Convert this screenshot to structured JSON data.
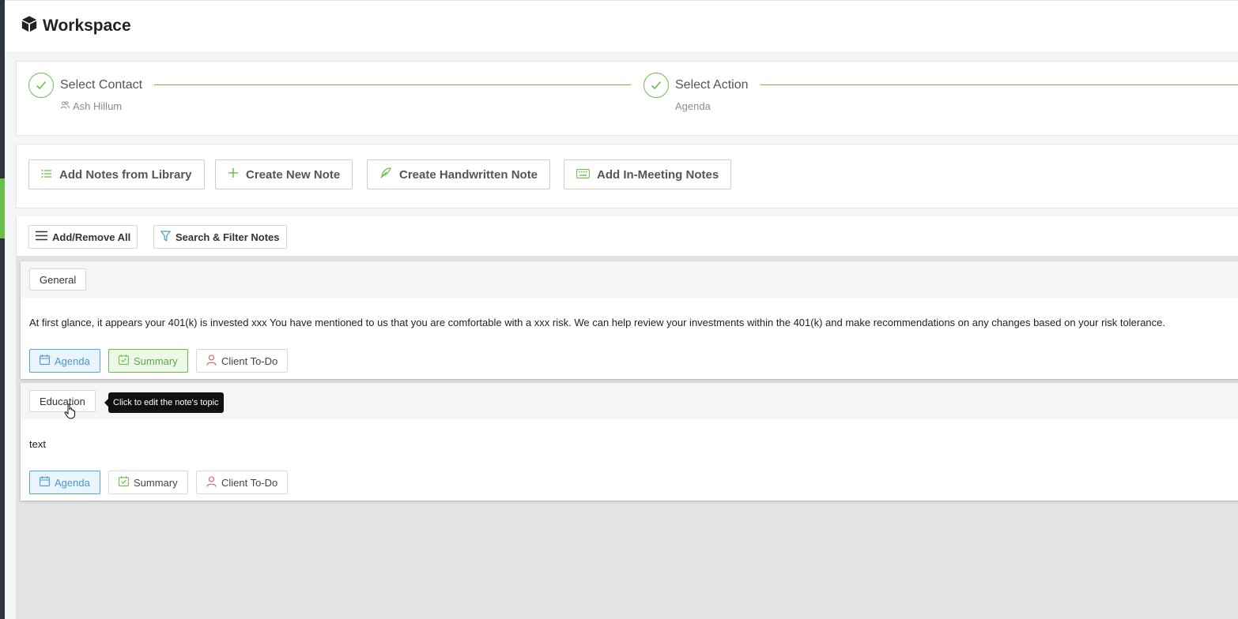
{
  "app": {
    "title": "Workspace",
    "icon": "cube-icon"
  },
  "stepper": {
    "steps": [
      {
        "title": "Select Contact",
        "subtitle": "Ash Hillum",
        "status": "complete",
        "sub_icon": "people-icon"
      },
      {
        "title": "Select Action",
        "subtitle": "Agenda",
        "status": "complete"
      }
    ]
  },
  "actions": [
    {
      "label": "Add Notes from Library",
      "icon": "list-icon"
    },
    {
      "label": "Create New Note",
      "icon": "plus-icon"
    },
    {
      "label": "Create Handwritten Note",
      "icon": "feather-icon"
    },
    {
      "label": "Add In-Meeting Notes",
      "icon": "keyboard-icon"
    }
  ],
  "notes_toolbar": {
    "add_remove_label": "Add/Remove All",
    "filter_label": "Search & Filter Notes"
  },
  "notes": [
    {
      "topic": "General",
      "text": "At first glance, it appears your 401(k) is invested xxx You have mentioned to us that you are comfortable with a xxx risk. We can help review your investments within the 401(k) and make recommendations on any changes based on your risk tolerance.",
      "tags": [
        {
          "label": "Agenda",
          "active": true
        },
        {
          "label": "Summary",
          "active": true
        },
        {
          "label": "Client To-Do",
          "active": false
        }
      ]
    },
    {
      "topic": "Education",
      "text": "text",
      "tags": [
        {
          "label": "Agenda",
          "active": true
        },
        {
          "label": "Summary",
          "active": false
        },
        {
          "label": "Client To-Do",
          "active": false
        }
      ]
    }
  ],
  "tooltip": "Click to edit the note's topic",
  "colors": {
    "accent_green": "#6abf4b",
    "accent_blue": "#4a97d1",
    "accent_red": "#d9534f",
    "rail": "#2f3540"
  }
}
